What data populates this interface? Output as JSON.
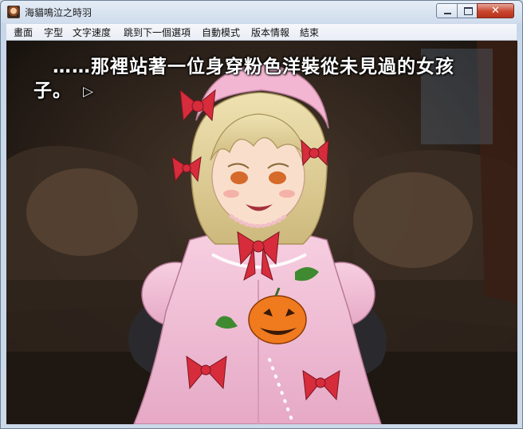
{
  "window": {
    "title": "海貓鳴泣之時羽"
  },
  "menu": {
    "items": [
      "畫面",
      "字型",
      "文字速度",
      "跳到下一個選項",
      "自動模式",
      "版本情報",
      "結束"
    ]
  },
  "dialog": {
    "line1": "……那裡站著一位身穿粉色洋裝從未見過的女孩",
    "line2": "子。",
    "continue_glyph": "▷"
  },
  "colors": {
    "dress": "#f2bfd6",
    "dress_shadow": "#d992b3",
    "ribbon": "#d62c3c",
    "hair": "#e9d8a0",
    "pumpkin": "#f07a1e",
    "background": "#2a2019"
  },
  "icons": {
    "app": "app-portrait-icon",
    "minimize": "minimize-icon",
    "maximize": "maximize-icon",
    "close": "close-icon",
    "continue": "continue-arrow-icon"
  }
}
